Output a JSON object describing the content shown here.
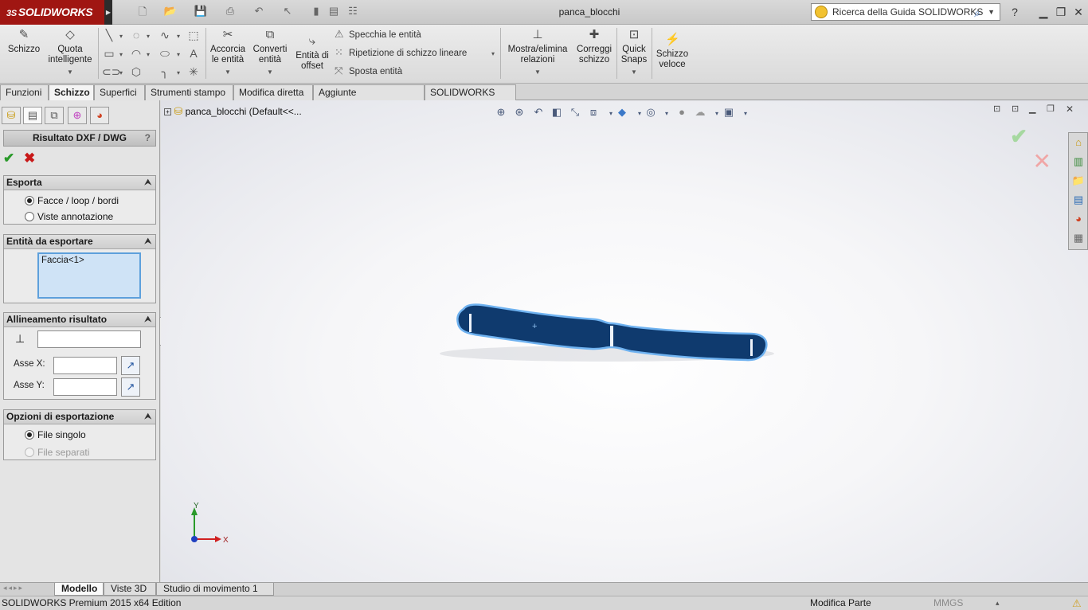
{
  "app": {
    "logo_text": "SOLIDWORKS",
    "document_title": "panca_blocchi"
  },
  "search": {
    "placeholder": "Ricerca della Guida SOLIDWORKS"
  },
  "ribbon": {
    "schizzo": "Schizzo",
    "quota_line1": "Quota",
    "quota_line2": "intelligente",
    "accorcia_line1": "Accorcia",
    "accorcia_line2": "le entità",
    "converti_line1": "Converti",
    "converti_line2": "entità",
    "offset_line1": "Entità di",
    "offset_line2": "offset",
    "specchia": "Specchia le entità",
    "ripetizione": "Ripetizione di schizzo lineare",
    "sposta": "Sposta entità",
    "mostra_line1": "Mostra/elimina",
    "mostra_line2": "relazioni",
    "correggi_line1": "Correggi",
    "correggi_line2": "schizzo",
    "snaps_line1": "Quick",
    "snaps_line2": "Snaps",
    "veloce_line1": "Schizzo",
    "veloce_line2": "veloce"
  },
  "tabs": [
    "Funzioni",
    "Schizzo",
    "Superfici",
    "Strumenti stampo",
    "Modifica diretta",
    "Aggiunte SOLIDWORKS",
    "SOLIDWORKS MBD"
  ],
  "property_manager": {
    "title": "Risultato DXF / DWG",
    "help": "?",
    "esporta": {
      "header": "Esporta",
      "option1": "Facce / loop / bordi",
      "option2": "Viste annotazione"
    },
    "entita": {
      "header": "Entità da esportare",
      "item": "Faccia<1>"
    },
    "allineamento": {
      "header": "Allineamento risultato",
      "asse_x": "Asse X:",
      "asse_y": "Asse Y:"
    },
    "opzioni": {
      "header": "Opzioni di esportazione",
      "option1": "File singolo",
      "option2": "File separati"
    }
  },
  "graphics": {
    "tree_item": "panca_blocchi",
    "tree_config": "(Default<<...",
    "axis_x": "X",
    "axis_y": "Y"
  },
  "bottom_tabs": [
    "Modello",
    "Viste 3D",
    "Studio di movimento 1"
  ],
  "status": {
    "edition": "SOLIDWORKS Premium 2015 x64 Edition",
    "mode": "Modifica Parte",
    "units": "MMGS"
  },
  "colors": {
    "part_fill": "#0f3a6e",
    "part_edge": "#6fb2f0",
    "brand_red": "#a01612"
  }
}
